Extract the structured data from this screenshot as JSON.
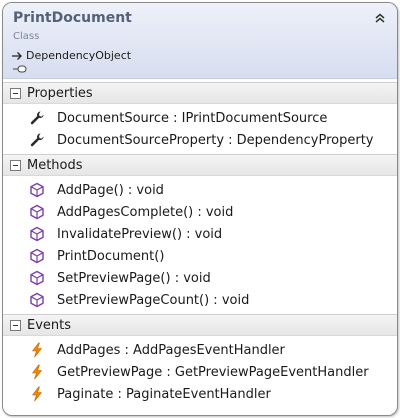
{
  "class": {
    "name": "PrintDocument",
    "stereotype": "Class",
    "base": "DependencyObject"
  },
  "compartments": {
    "properties": {
      "title": "Properties",
      "items": [
        "DocumentSource : IPrintDocumentSource",
        "DocumentSourceProperty : DependencyProperty"
      ]
    },
    "methods": {
      "title": "Methods",
      "items": [
        "AddPage() : void",
        "AddPagesComplete() : void",
        "InvalidatePreview() : void",
        "PrintDocument()",
        "SetPreviewPage() : void",
        "SetPreviewPageCount() : void"
      ]
    },
    "events": {
      "title": "Events",
      "items": [
        "AddPages : AddPagesEventHandler",
        "GetPreviewPage : GetPreviewPageEventHandler",
        "Paginate : PaginateEventHandler"
      ]
    }
  },
  "icons": {
    "property": "wrench-icon",
    "method": "method-cube-icon",
    "event": "lightning-icon",
    "collapse": "double-chevron-up-icon"
  },
  "colors": {
    "header_gradient_top": "#eef1f9",
    "header_gradient_bottom": "#d7def0",
    "class_name": "#556177",
    "method_icon": "#7b3fa6",
    "event_icon": "#e07b00"
  }
}
